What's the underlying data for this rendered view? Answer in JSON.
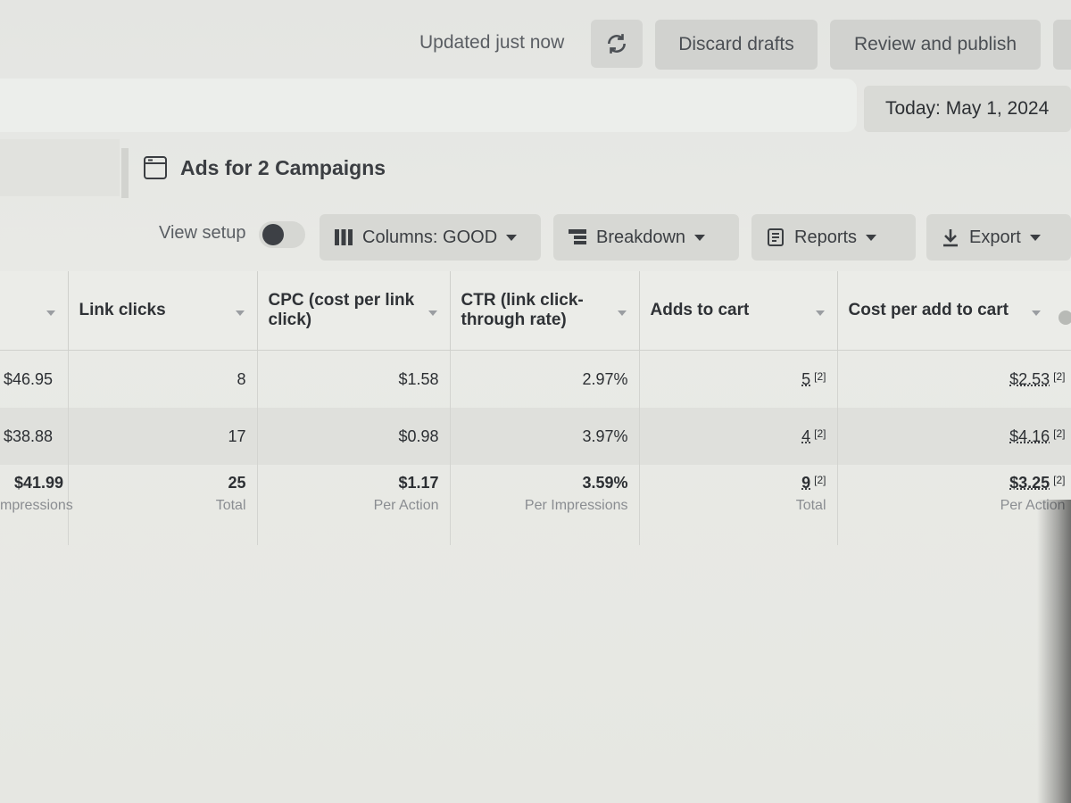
{
  "header": {
    "updated_text": "Updated just now",
    "discard_label": "Discard drafts",
    "review_label": "Review and publish"
  },
  "date": {
    "label": "Today: May 1, 2024"
  },
  "campaign": {
    "title": "Ads for 2 Campaigns"
  },
  "toolbar": {
    "view_setup_label": "View setup",
    "view_setup_on": false,
    "columns_label": "Columns: GOOD",
    "breakdown_label": "Breakdown",
    "reports_label": "Reports",
    "export_label": "Export"
  },
  "table": {
    "columns": [
      "",
      "Link clicks",
      "CPC (cost per link click)",
      "CTR (link click-through rate)",
      "Adds to cart",
      "Cost per add to cart"
    ],
    "rows": [
      {
        "first": "$46.95",
        "link_clicks": "8",
        "cpc": "$1.58",
        "ctr": "2.97%",
        "adds": "5",
        "adds_note": "[2]",
        "cost_add": "$2.53",
        "cost_add_note": "[2]"
      },
      {
        "first": "$38.88",
        "link_clicks": "17",
        "cpc": "$0.98",
        "ctr": "3.97%",
        "adds": "4",
        "adds_note": "[2]",
        "cost_add": "$4.16",
        "cost_add_note": "[2]"
      }
    ],
    "summary": {
      "first": "$41.99",
      "first_sub": "mpressions",
      "link_clicks": "25",
      "link_clicks_sub": "Total",
      "cpc": "$1.17",
      "cpc_sub": "Per Action",
      "ctr": "3.59%",
      "ctr_sub": "Per Impressions",
      "adds": "9",
      "adds_note": "[2]",
      "adds_sub": "Total",
      "cost_add": "$3.25",
      "cost_add_note": "[2]",
      "cost_add_sub": "Per Action"
    }
  },
  "colors": {
    "background": "#e6e7e2",
    "button_bg": "#d1d2cf",
    "text_dark": "#2c2f33",
    "text_muted": "#8a8d91"
  }
}
